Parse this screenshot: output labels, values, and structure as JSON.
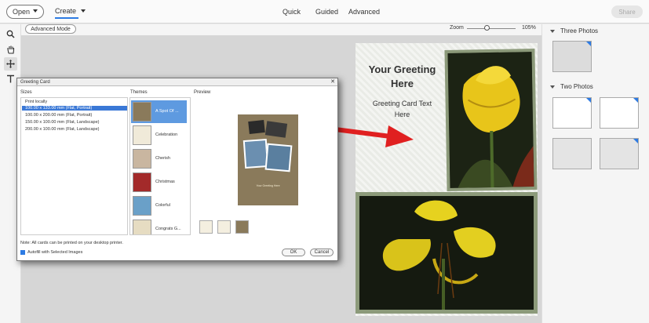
{
  "topbar": {
    "open_label": "Open",
    "create_label": "Create",
    "modes": [
      "Quick",
      "Guided",
      "Advanced"
    ],
    "share_label": "Share"
  },
  "subbar": {
    "advanced_mode_label": "Advanced Mode",
    "zoom_label": "Zoom",
    "zoom_value": "105%",
    "zoom_level": 0.36
  },
  "card": {
    "title": "Your Greeting Here",
    "subtitle": "Greeting Card Text Here"
  },
  "rightpanel": {
    "section1": "Three Photos",
    "section2": "Two Photos"
  },
  "dialog": {
    "title": "Greeting Card",
    "close": "✕",
    "sizes_header": "Sizes",
    "themes_header": "Themes",
    "preview_header": "Preview",
    "sizes": [
      "Print locally",
      "100.00 x 133.00 mm (Flat, Portrait)",
      "100.00 x 200.00 mm (Flat, Portrait)",
      "150.00 x 100.00 mm (Flat, Landscape)",
      "200.00 x 100.00 mm (Flat, Landscape)"
    ],
    "themes": [
      "A Spot Of ...",
      "Celebration",
      "Cherish",
      "Christmas",
      "Colorful",
      "Congrats G..."
    ],
    "preview_card_title": "Your Greeting Here",
    "note": "Note: All cards can be printed on your desktop printer.",
    "autofill_label": "Autofill with Selected Images",
    "ok_label": "OK",
    "cancel_label": "Cancel"
  },
  "colors": {
    "accent": "#2d7be3",
    "selection": "#3a78d6",
    "arrow": "#e02020"
  },
  "icons": [
    "zoom-icon",
    "hand-icon",
    "move-icon",
    "text-icon"
  ]
}
